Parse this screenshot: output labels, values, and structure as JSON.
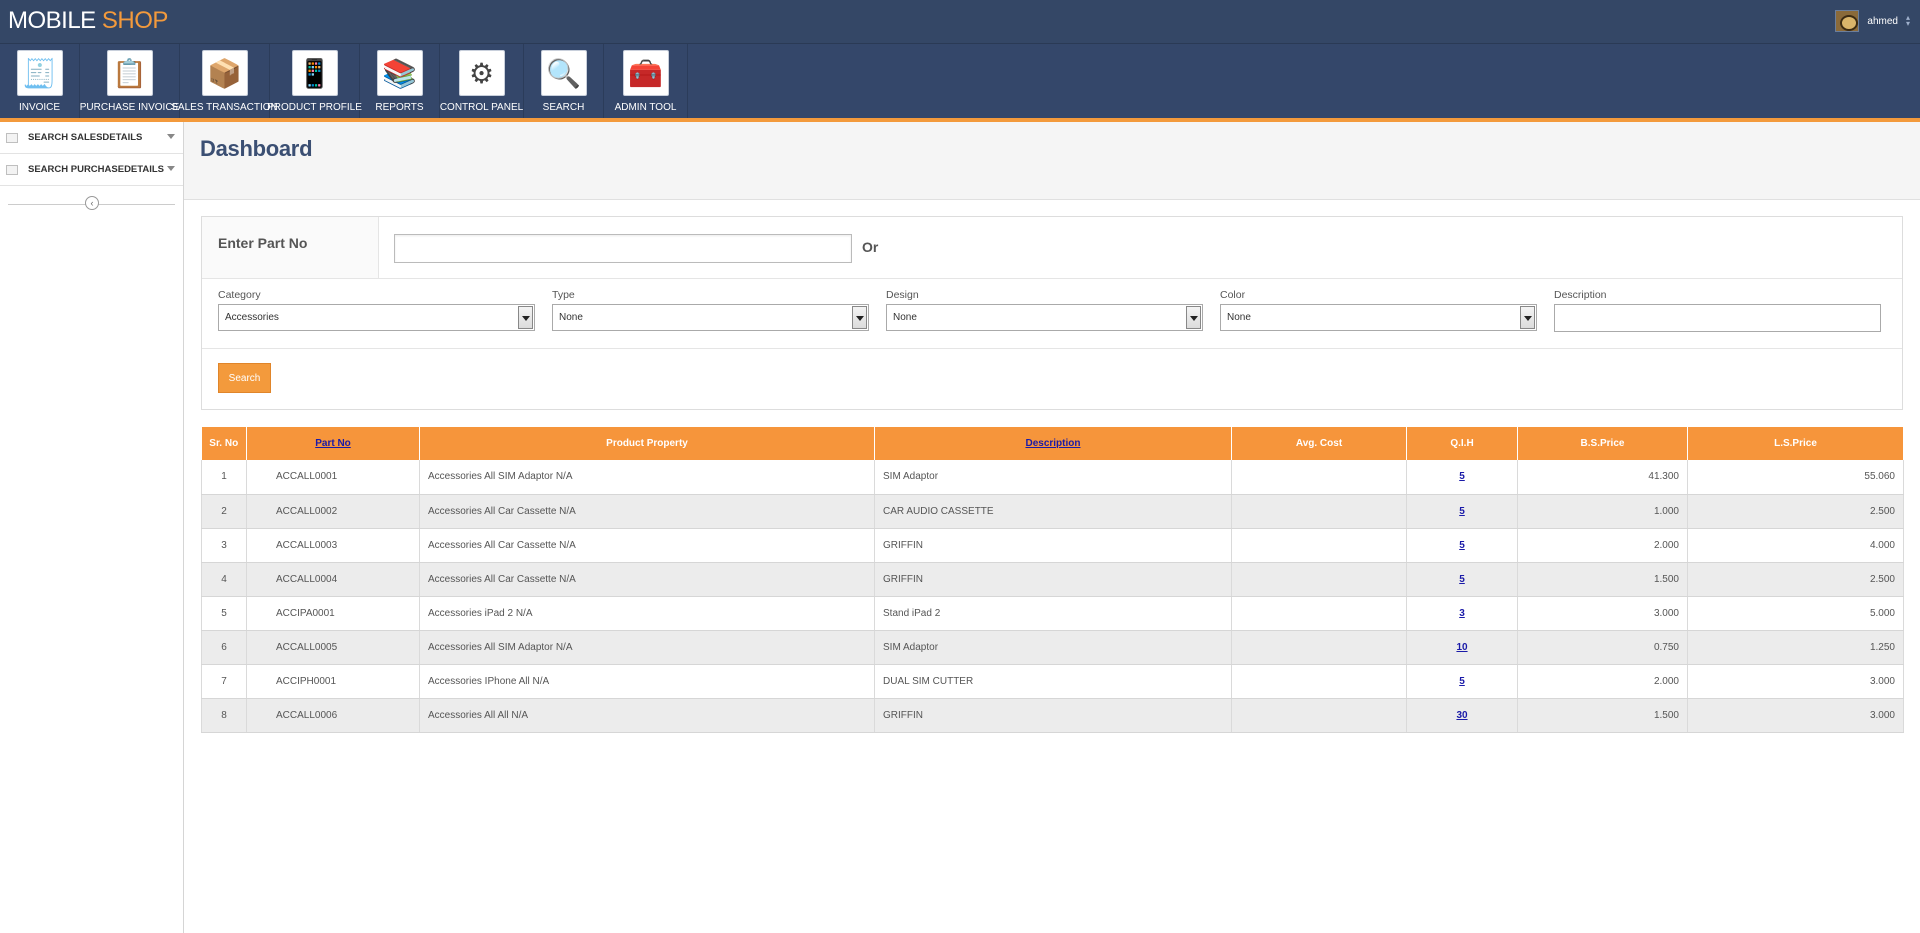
{
  "brand": {
    "part1": "MOBILE",
    "part2": "SHOP"
  },
  "user": {
    "name": "ahmed"
  },
  "toolbar": [
    {
      "label": "INVOICE",
      "icon": "invoice-icon",
      "glyph": "🧾"
    },
    {
      "label": "PURCHASE INVOICE",
      "icon": "purchase-invoice-icon",
      "glyph": "📋"
    },
    {
      "label": "SALES TRANSACTION",
      "icon": "sales-transaction-icon",
      "glyph": "📦"
    },
    {
      "label": "PRODUCT PROFILE",
      "icon": "product-profile-icon",
      "glyph": "📱"
    },
    {
      "label": "REPORTS",
      "icon": "reports-icon",
      "glyph": "📚"
    },
    {
      "label": "CONTROL PANEL",
      "icon": "control-panel-icon",
      "glyph": "⚙"
    },
    {
      "label": "SEARCH",
      "icon": "search-icon",
      "glyph": "🔍"
    },
    {
      "label": "ADMIN TOOL",
      "icon": "admin-tool-icon",
      "glyph": "🧰"
    }
  ],
  "sidebar": {
    "items": [
      {
        "label": "SEARCH SALESDETAILS"
      },
      {
        "label": "SEARCH PURCHASEDETAILS"
      }
    ]
  },
  "page_title": "Dashboard",
  "search": {
    "partno_label": "Enter Part No",
    "partno_value": "",
    "or_label": "Or",
    "filters": {
      "category": {
        "label": "Category",
        "value": "Accessories"
      },
      "type": {
        "label": "Type",
        "value": "None"
      },
      "design": {
        "label": "Design",
        "value": "None"
      },
      "color": {
        "label": "Color",
        "value": "None"
      },
      "description": {
        "label": "Description",
        "value": ""
      }
    },
    "button_label": "Search"
  },
  "table": {
    "columns": {
      "sr_no": "Sr. No",
      "part_no": "Part No",
      "product_property": "Product Property",
      "description": "Description",
      "avg_cost": "Avg. Cost",
      "qih": "Q.I.H",
      "bs_price": "B.S.Price",
      "ls_price": "L.S.Price"
    },
    "rows": [
      {
        "sr": "1",
        "part": "ACCALL0001",
        "prop": "Accessories All SIM Adaptor N/A",
        "desc": "SIM Adaptor",
        "avg": "",
        "qih": "5",
        "bs": "41.300",
        "ls": "55.060"
      },
      {
        "sr": "2",
        "part": "ACCALL0002",
        "prop": "Accessories All Car Cassette N/A",
        "desc": "CAR AUDIO CASSETTE",
        "avg": "",
        "qih": "5",
        "bs": "1.000",
        "ls": "2.500"
      },
      {
        "sr": "3",
        "part": "ACCALL0003",
        "prop": "Accessories All Car Cassette N/A",
        "desc": "GRIFFIN",
        "avg": "",
        "qih": "5",
        "bs": "2.000",
        "ls": "4.000"
      },
      {
        "sr": "4",
        "part": "ACCALL0004",
        "prop": "Accessories All Car Cassette N/A",
        "desc": "GRIFFIN",
        "avg": "",
        "qih": "5",
        "bs": "1.500",
        "ls": "2.500"
      },
      {
        "sr": "5",
        "part": "ACCIPA0001",
        "prop": "Accessories iPad 2 N/A",
        "desc": "Stand iPad 2",
        "avg": "",
        "qih": "3",
        "bs": "3.000",
        "ls": "5.000"
      },
      {
        "sr": "6",
        "part": "ACCALL0005",
        "prop": "Accessories All SIM Adaptor N/A",
        "desc": "SIM Adaptor",
        "avg": "",
        "qih": "10",
        "bs": "0.750",
        "ls": "1.250"
      },
      {
        "sr": "7",
        "part": "ACCIPH0001",
        "prop": "Accessories IPhone All N/A",
        "desc": "DUAL SIM CUTTER",
        "avg": "",
        "qih": "5",
        "bs": "2.000",
        "ls": "3.000"
      },
      {
        "sr": "8",
        "part": "ACCALL0006",
        "prop": "Accessories All All N/A",
        "desc": "GRIFFIN",
        "avg": "",
        "qih": "30",
        "bs": "1.500",
        "ls": "3.000"
      }
    ]
  }
}
